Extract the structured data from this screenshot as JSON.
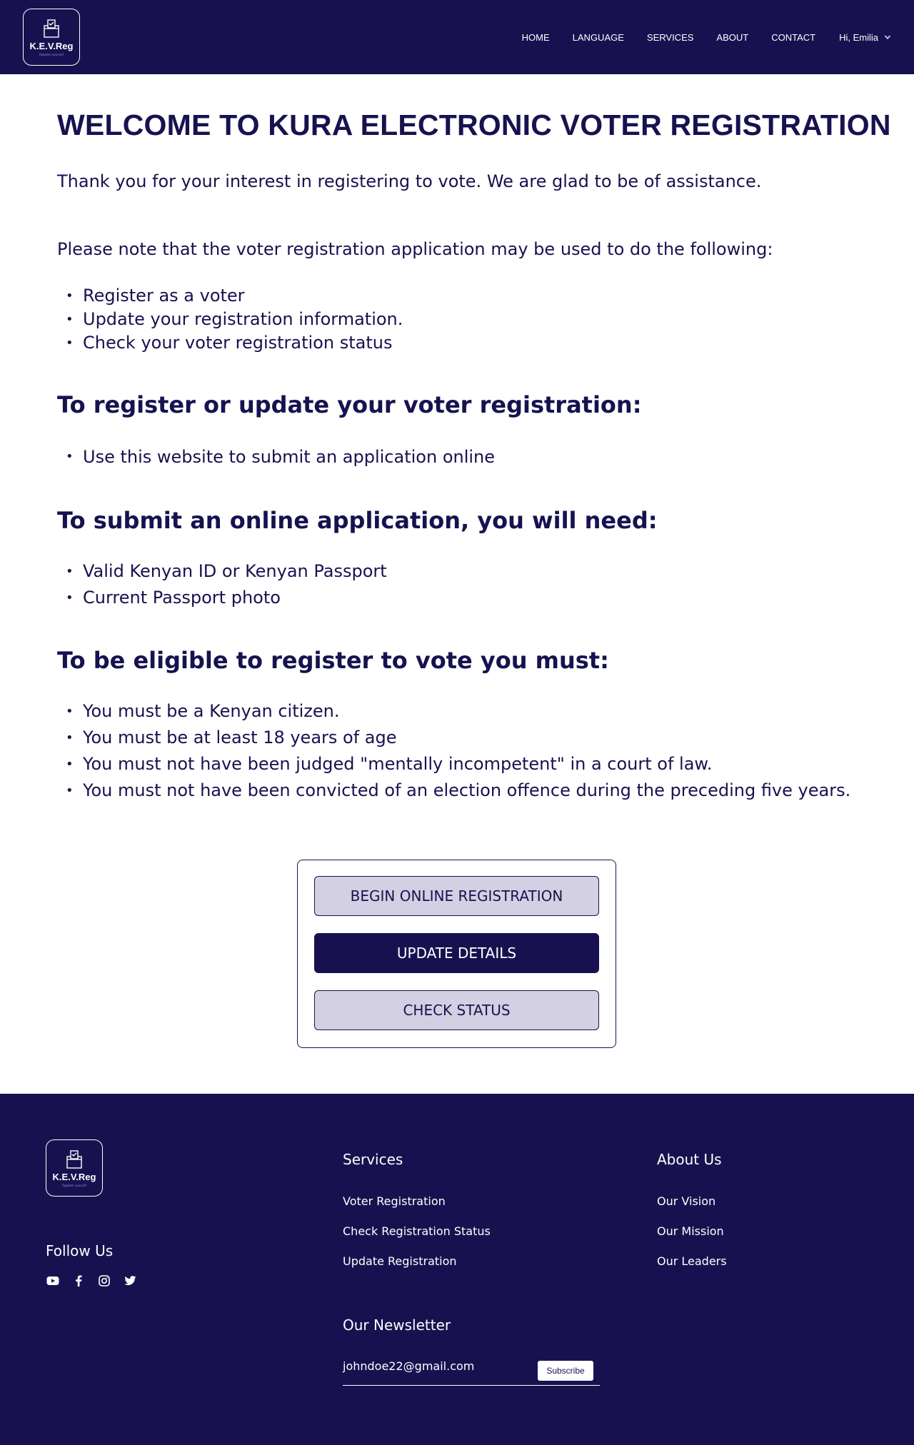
{
  "brand": {
    "name": "K.E.V.Reg",
    "tagline": "Register yourself"
  },
  "nav": {
    "items": [
      {
        "label": "HOME"
      },
      {
        "label": "LANGUAGE"
      },
      {
        "label": "SERVICES"
      },
      {
        "label": "ABOUT"
      },
      {
        "label": "CONTACT"
      }
    ],
    "user_greeting": "Hi, Emilia"
  },
  "main": {
    "title": "WELCOME TO KURA ELECTRONIC VOTER REGISTRATION",
    "intro": "Thank you for your interest in registering to vote. We are glad to be of assistance.",
    "note": "Please note that the voter registration application may be used to do the following:",
    "uses": [
      "Register as a voter",
      "Update your registration information.",
      "Check your voter registration status"
    ],
    "update_heading": "To register or update your voter registration:",
    "update_items": [
      "Use this website to submit an application online"
    ],
    "need_heading": "To submit an online application, you will need:",
    "need_items": [
      "Valid Kenyan ID or Kenyan Passport",
      "Current Passport photo"
    ],
    "eligibility_heading": "To be eligible to register to vote you must:",
    "eligibility_items": [
      "You must be a Kenyan citizen.",
      "You must be at least 18 years of age",
      "You must not have been judged \"mentally incompetent\" in a court of law.",
      "You must not have been convicted of an election offence during the preceding five years."
    ]
  },
  "actions": {
    "begin": "BEGIN ONLINE REGISTRATION",
    "update": "UPDATE DETAILS",
    "status": "CHECK STATUS"
  },
  "footer": {
    "follow_heading": "Follow Us",
    "social_icons": [
      "youtube-icon",
      "facebook-icon",
      "instagram-icon",
      "twitter-icon"
    ],
    "services_heading": "Services",
    "services_links": [
      "Voter Registration",
      "Check Registration Status",
      "Update Registration"
    ],
    "about_heading": "About Us",
    "about_links": [
      "Our Vision",
      "Our Mission",
      "Our Leaders"
    ],
    "newsletter_heading": "Our Newsletter",
    "newsletter_email": "johndoe22@gmail.com",
    "subscribe_label": "Subscribe"
  },
  "colors": {
    "primary": "#17124f",
    "button_light": "#d2d0e2",
    "white": "#ffffff"
  }
}
